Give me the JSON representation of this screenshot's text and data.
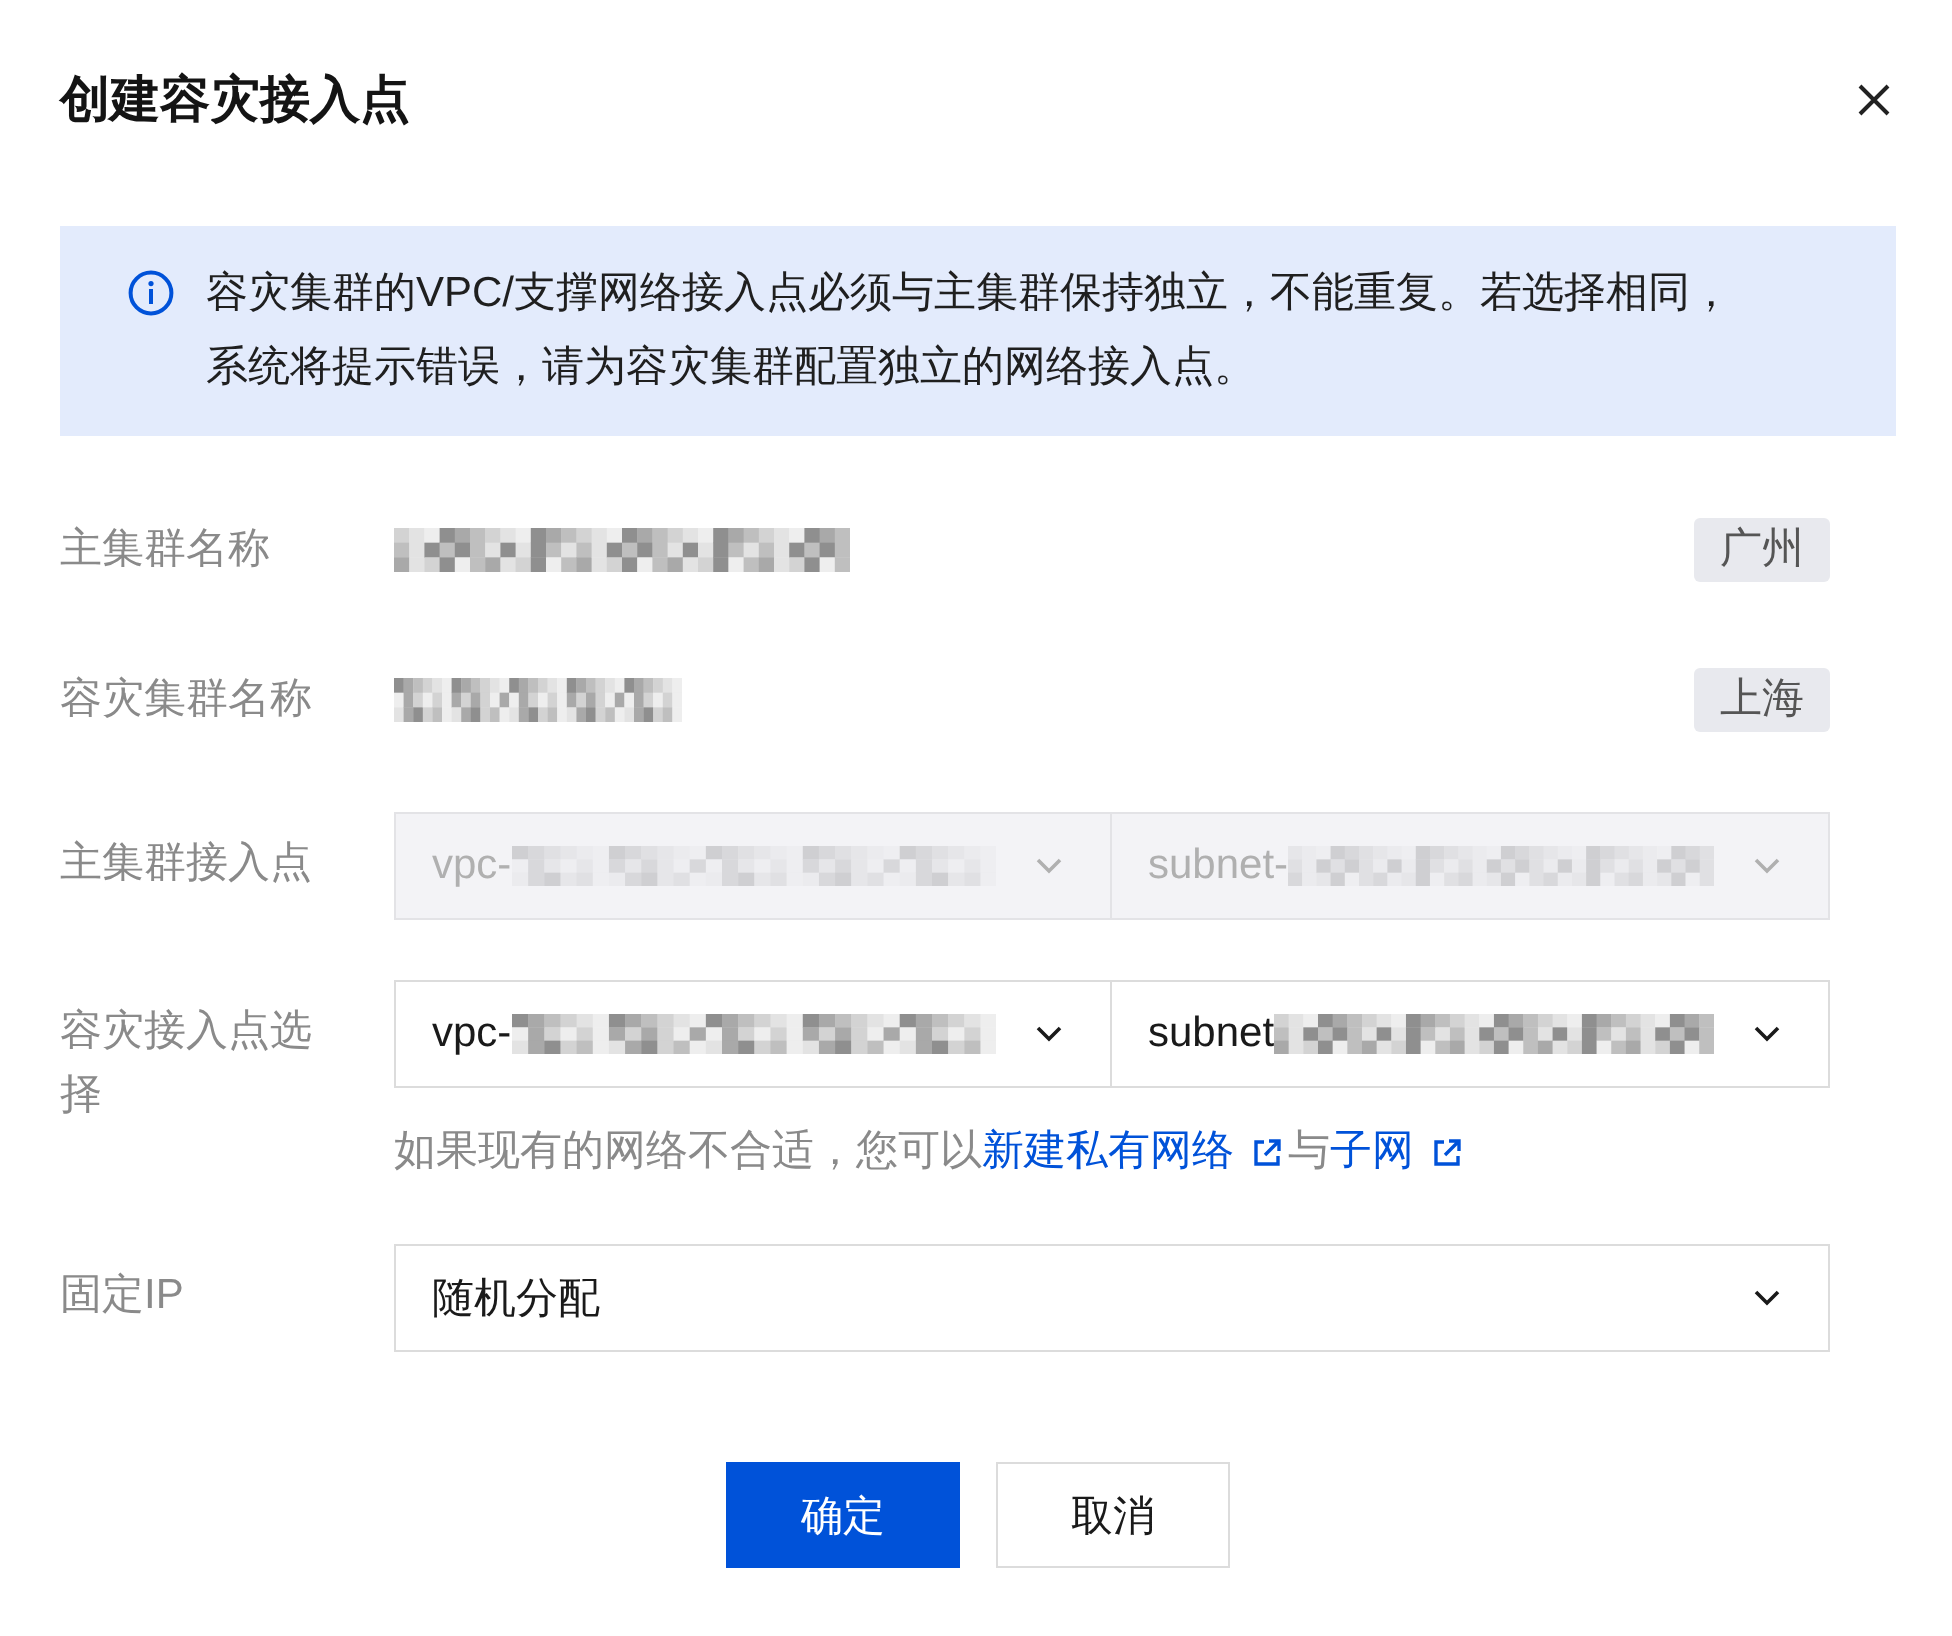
{
  "dialog": {
    "title": "创建容灾接入点"
  },
  "alert": {
    "kind": "info",
    "text": "容灾集群的VPC/支撑网络接入点必须与主集群保持独立，不能重复。若选择相同，系统将提示错误，请为容灾集群配置独立的网络接入点。"
  },
  "form": {
    "rows": [
      {
        "kind": "name",
        "label": "主集群名称",
        "redacted": true,
        "tag": "广州"
      },
      {
        "kind": "name",
        "label": "容灾集群名称",
        "redacted": true,
        "tag": "上海"
      },
      {
        "kind": "select_pair",
        "label": "主集群接入点",
        "selects": [
          {
            "value": "vpc-",
            "redacted": true,
            "disabled": true
          },
          {
            "value": "subnet-",
            "redacted": true,
            "disabled": true
          }
        ]
      },
      {
        "kind": "select_pair",
        "label": "容灾接入点选择",
        "selects": [
          {
            "value": "vpc-",
            "redacted": true,
            "disabled": false
          },
          {
            "value": "subnet",
            "redacted": true,
            "disabled": false
          }
        ],
        "help": [
          {
            "kind": "text",
            "text": "如果现有的网络不合适，您可以"
          },
          {
            "kind": "link",
            "text": "新建私有网络"
          },
          {
            "kind": "text",
            "text": "与"
          },
          {
            "kind": "link",
            "text": "子网"
          }
        ]
      },
      {
        "kind": "select",
        "label": "固定IP",
        "value": "随机分配",
        "disabled": false
      }
    ]
  },
  "buttons": [
    {
      "kind": "primary",
      "label": "确定"
    },
    {
      "kind": "secondary",
      "label": "取消"
    }
  ]
}
